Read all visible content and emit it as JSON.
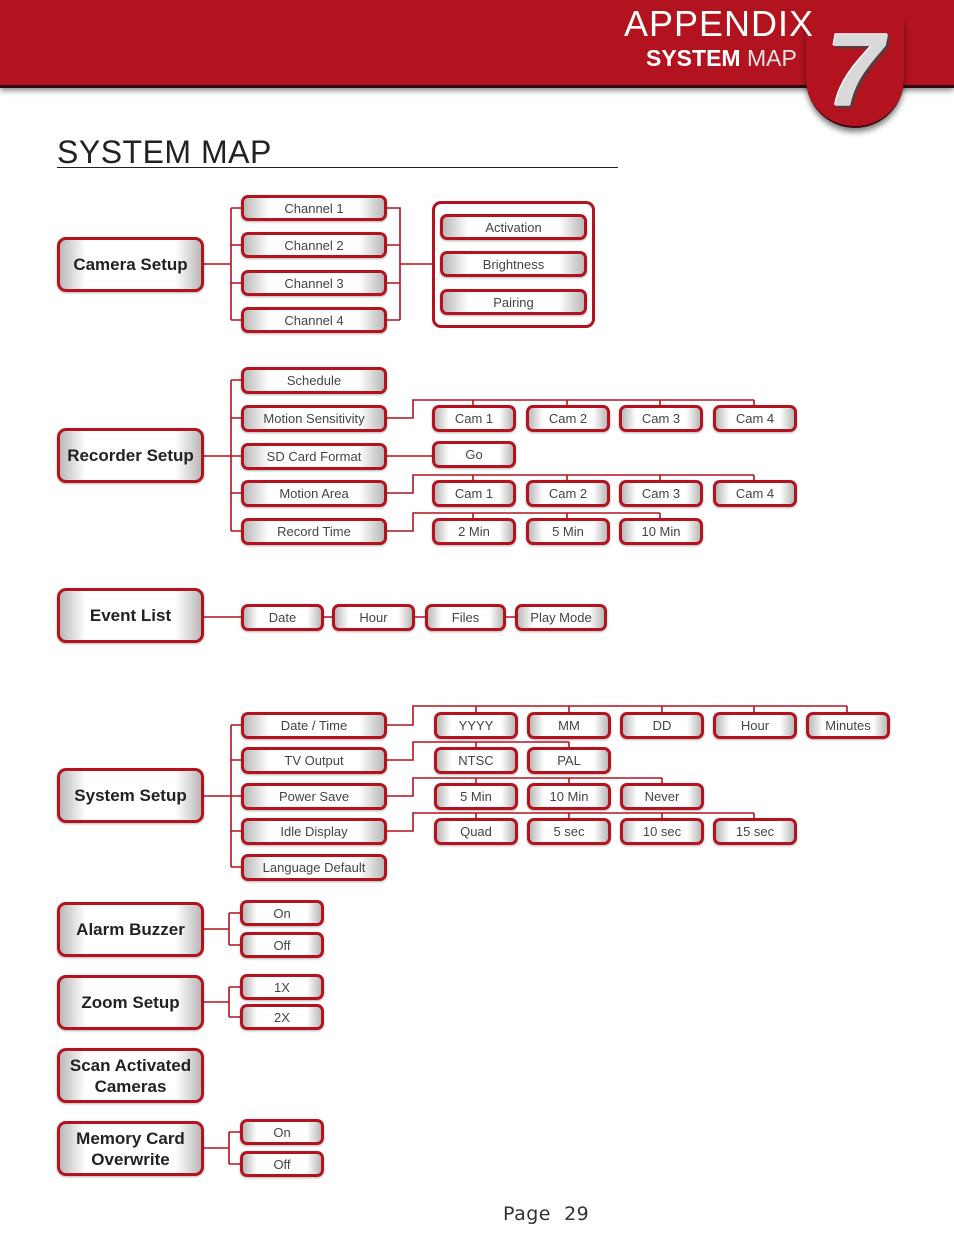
{
  "header": {
    "appendix_label": "APPENDIX",
    "section_strong": "SYSTEM",
    "section_light": "MAP",
    "chapter_number": "7"
  },
  "page_title": "SYSTEM MAP",
  "colors": {
    "accent": "#b3131f",
    "text": "#444444"
  },
  "camera_setup": {
    "label": "Camera Setup",
    "channels": [
      "Channel 1",
      "Channel 2",
      "Channel 3",
      "Channel 4"
    ],
    "options": [
      "Activation",
      "Brightness",
      "Pairing"
    ]
  },
  "recorder_setup": {
    "label": "Recorder Setup",
    "items": [
      "Schedule",
      "Motion Sensitivity",
      "SD Card Format",
      "Motion Area",
      "Record Time"
    ],
    "motion_sensitivity_options": [
      "Cam 1",
      "Cam 2",
      "Cam 3",
      "Cam 4"
    ],
    "sd_card_format_options": [
      "Go"
    ],
    "motion_area_options": [
      "Cam 1",
      "Cam 2",
      "Cam 3",
      "Cam 4"
    ],
    "record_time_options": [
      "2 Min",
      "5 Min",
      "10 Min"
    ]
  },
  "event_list": {
    "label": "Event List",
    "items": [
      "Date",
      "Hour",
      "Files",
      "Play Mode"
    ]
  },
  "system_setup": {
    "label": "System Setup",
    "items": [
      "Date / Time",
      "TV Output",
      "Power Save",
      "Idle Display",
      "Language Default"
    ],
    "date_time_options": [
      "YYYY",
      "MM",
      "DD",
      "Hour",
      "Minutes"
    ],
    "tv_output_options": [
      "NTSC",
      "PAL"
    ],
    "power_save_options": [
      "5 Min",
      "10 Min",
      "Never"
    ],
    "idle_display_options": [
      "Quad",
      "5 sec",
      "10 sec",
      "15 sec"
    ]
  },
  "alarm_buzzer": {
    "label": "Alarm Buzzer",
    "options": [
      "On",
      "Off"
    ]
  },
  "zoom_setup": {
    "label": "Zoom Setup",
    "options": [
      "1X",
      "2X"
    ]
  },
  "scan_activated_cameras": {
    "label": "Scan Activated Cameras"
  },
  "memory_card_overwrite": {
    "label": "Memory Card Overwrite",
    "options": [
      "On",
      "Off"
    ]
  },
  "footer": {
    "page_label": "Page  29"
  }
}
